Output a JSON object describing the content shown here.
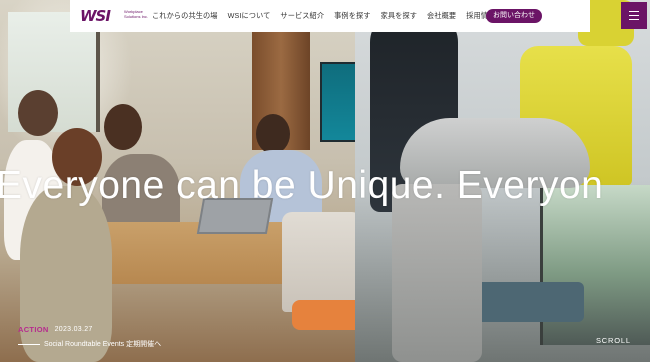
{
  "brand": {
    "logo_mark": "WSI",
    "logo_sub": "Workplace Solutions Inc.",
    "accent_color": "#6b1466"
  },
  "nav": {
    "items": [
      {
        "label": "これからの共生の場"
      },
      {
        "label": "WSIについて"
      },
      {
        "label": "サービス紹介"
      },
      {
        "label": "事例を探す"
      },
      {
        "label": "家具を探す"
      },
      {
        "label": "会社概要"
      },
      {
        "label": "採用情報"
      }
    ],
    "contact_label": "お問い合わせ",
    "menu_icon": "hamburger-icon"
  },
  "hero": {
    "tagline": "Everyone can be Unique.  Everyon"
  },
  "news": {
    "tag": "ACTION",
    "date": "2023.03.27",
    "title": "Social Roundtable Events 定期開催へ"
  },
  "scroll_label": "SCROLL"
}
